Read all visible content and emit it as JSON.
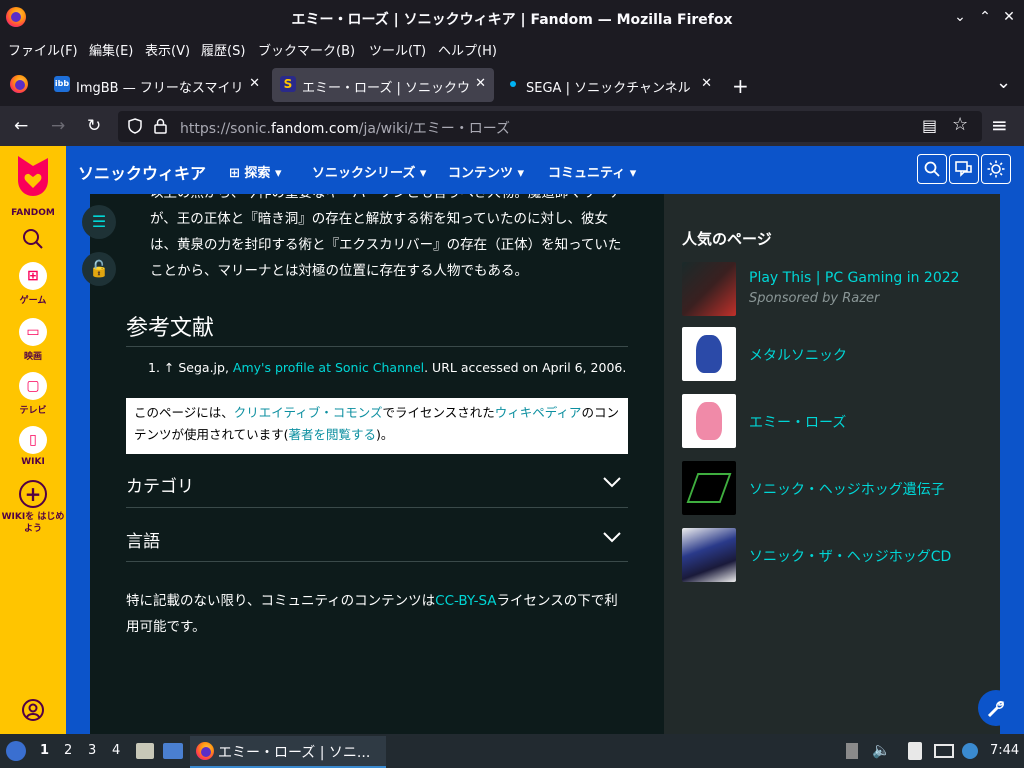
{
  "window": {
    "title": "エミー・ローズ | ソニックウィキア | Fandom — Mozilla Firefox",
    "minimize": "⌄",
    "maximize": "⌃",
    "close": "✕"
  },
  "menubar": [
    {
      "label": "ファイル(F)"
    },
    {
      "label": "編集(E)"
    },
    {
      "label": "表示(V)"
    },
    {
      "label": "履歴(S)"
    },
    {
      "label": "ブックマーク(B)"
    },
    {
      "label": "ツール(T)"
    },
    {
      "label": "ヘルプ(H)"
    }
  ],
  "tabs": [
    {
      "label": "ImgBB — フリーなスマイリ",
      "icon": "imgbb-icon",
      "close": "✕"
    },
    {
      "label": "エミー・ローズ | ソニックウ",
      "icon": "sonic-wiki-icon",
      "close": "✕"
    },
    {
      "label": "SEGA | ソニックチャンネル",
      "icon": "dot-icon",
      "close": "✕"
    }
  ],
  "tabbar": {
    "new_tab": "+",
    "list_all": "⌄"
  },
  "nav": {
    "back": "←",
    "forward": "→",
    "reload": "↻",
    "url_prefix": "https://sonic.",
    "url_host": "fandom.com",
    "url_path": "/ja/wiki/エミー・ローズ",
    "reader": "▤",
    "bookmark": "☆",
    "menu": "≡"
  },
  "fandom_sidebar": {
    "logo_label": "FANDOM",
    "items": [
      {
        "label": "ゲーム",
        "icon": "gamepad-icon"
      },
      {
        "label": "映画",
        "icon": "movie-icon"
      },
      {
        "label": "テレビ",
        "icon": "tv-icon"
      },
      {
        "label": "WIKI",
        "icon": "book-icon"
      },
      {
        "label": "WIKIを はじめよう",
        "icon": "plus-circle-icon"
      }
    ]
  },
  "wiki_header": {
    "name": "ソニックウィキア",
    "nav": [
      {
        "label": "探索"
      },
      {
        "label": "ソニックシリーズ"
      },
      {
        "label": "コンテンツ"
      },
      {
        "label": "コミュニティ"
      }
    ]
  },
  "article": {
    "intro": "以上の点から、今作の重要なキーパーソンとも言うべき人物。魔道師マリーナが、王の正体と『暗き洞』の存在と解放する術を知っていたのに対し、彼女は、黄泉の力を封印する術と『エクスカリバー』の存在（正体）を知っていたことから、マリーナとは対極の位置に存在する人物でもある。",
    "references_heading": "参考文献",
    "reference": {
      "prefix": "1. ↑ ",
      "source": "Sega.jp, ",
      "link": "Amy's profile at Sonic Channel",
      "suffix": ". URL accessed on April 6, 2006."
    },
    "license_box": {
      "t1": "このページには、",
      "l1": "クリエイティブ・コモンズ",
      "t2": "でライセンスされた",
      "l2": "ウィキペディア",
      "t3": "のコンテンツが使用されています(",
      "l3": "著者を閲覧する",
      "t4": ")。"
    },
    "categories": "カテゴリ",
    "languages": "言語",
    "footer": {
      "t1": "特に記載のない限り、コミュニティのコンテンツは",
      "link": "CC-BY-SA",
      "t2": "ライセンスの下で利用可能です。"
    }
  },
  "popular": {
    "heading": "人気のページ",
    "items": [
      {
        "title": "Play This | PC Gaming in 2022",
        "subtitle": "Sponsored by Razer"
      },
      {
        "title": "メタルソニック"
      },
      {
        "title": "エミー・ローズ"
      },
      {
        "title": "ソニック・ヘッジホッグ遺伝子"
      },
      {
        "title": "ソニック・ザ・ヘッジホッグCD"
      }
    ]
  },
  "taskbar": {
    "workspaces": [
      "1",
      "2",
      "3",
      "4"
    ],
    "window_label": "エミー・ローズ | ソニ...",
    "time": "7:44"
  }
}
